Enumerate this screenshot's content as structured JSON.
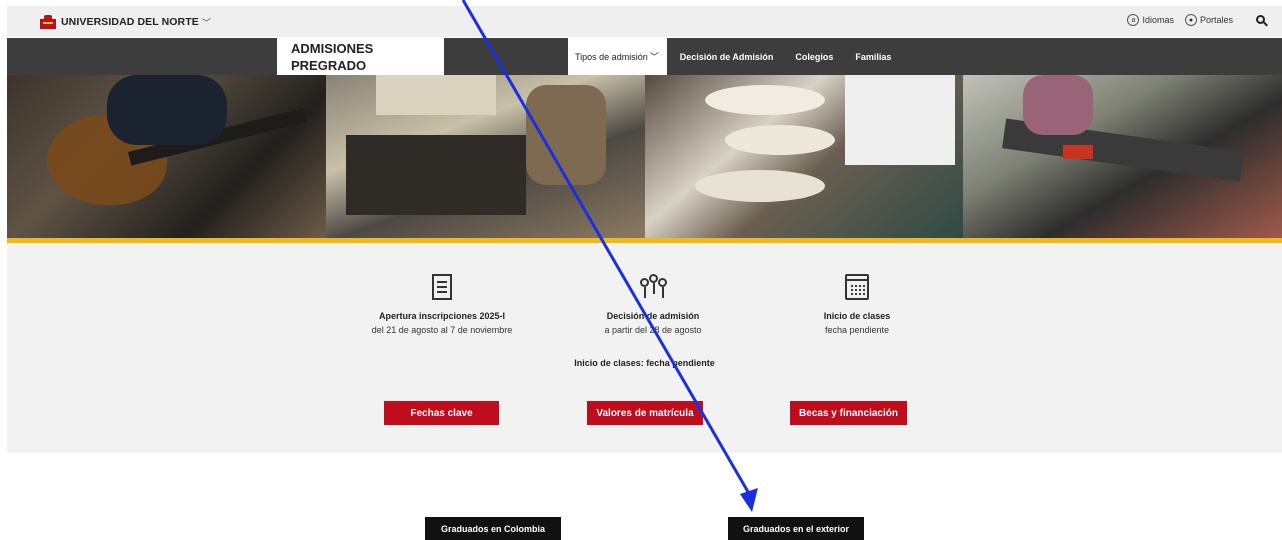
{
  "header": {
    "logo_text": "UNIVERSIDAD DEL NORTE",
    "logo_chevron": "﹀",
    "idiomas_icon_letter": "a",
    "idiomas_label": "Idiomas",
    "portales_label": "Portales",
    "brand_red": "#b5121b"
  },
  "nav": {
    "section_title_line1": "ADMISIONES",
    "section_title_line2": "PREGRADO",
    "links": [
      "Tipos de admisión",
      "Decisión de Admisión",
      "Colegios",
      "Familias"
    ],
    "active_chevron": "﹀"
  },
  "hero": {
    "panels": [
      "guitar-photo",
      "saw-workshop-photo",
      "model-tower-photo",
      "conveyor-lab-photo"
    ],
    "accent_bar_color": "#f2b818"
  },
  "info": {
    "items": [
      {
        "icon": "form-edit-icon",
        "title": "Apertura inscripciones 2025-I",
        "subtitle": "del 21 de agosto al 7 de noviembre"
      },
      {
        "icon": "keys-icon",
        "title": "Decisión de admisión",
        "subtitle": "a partir del 28 de agosto"
      },
      {
        "icon": "calendar-icon",
        "title": "Inicio de clases",
        "subtitle": "fecha pendiente"
      }
    ],
    "note": "Inicio de clases: fecha pendiente",
    "buttons": [
      "Fechas clave",
      "Valores de matrícula",
      "Becas y financiación"
    ],
    "button_color": "#c00d1e"
  },
  "bottom_buttons": [
    "Graduados en Colombia",
    "Graduados en el exterior"
  ],
  "annotation": {
    "arrow_color": "#1a2fe0"
  }
}
